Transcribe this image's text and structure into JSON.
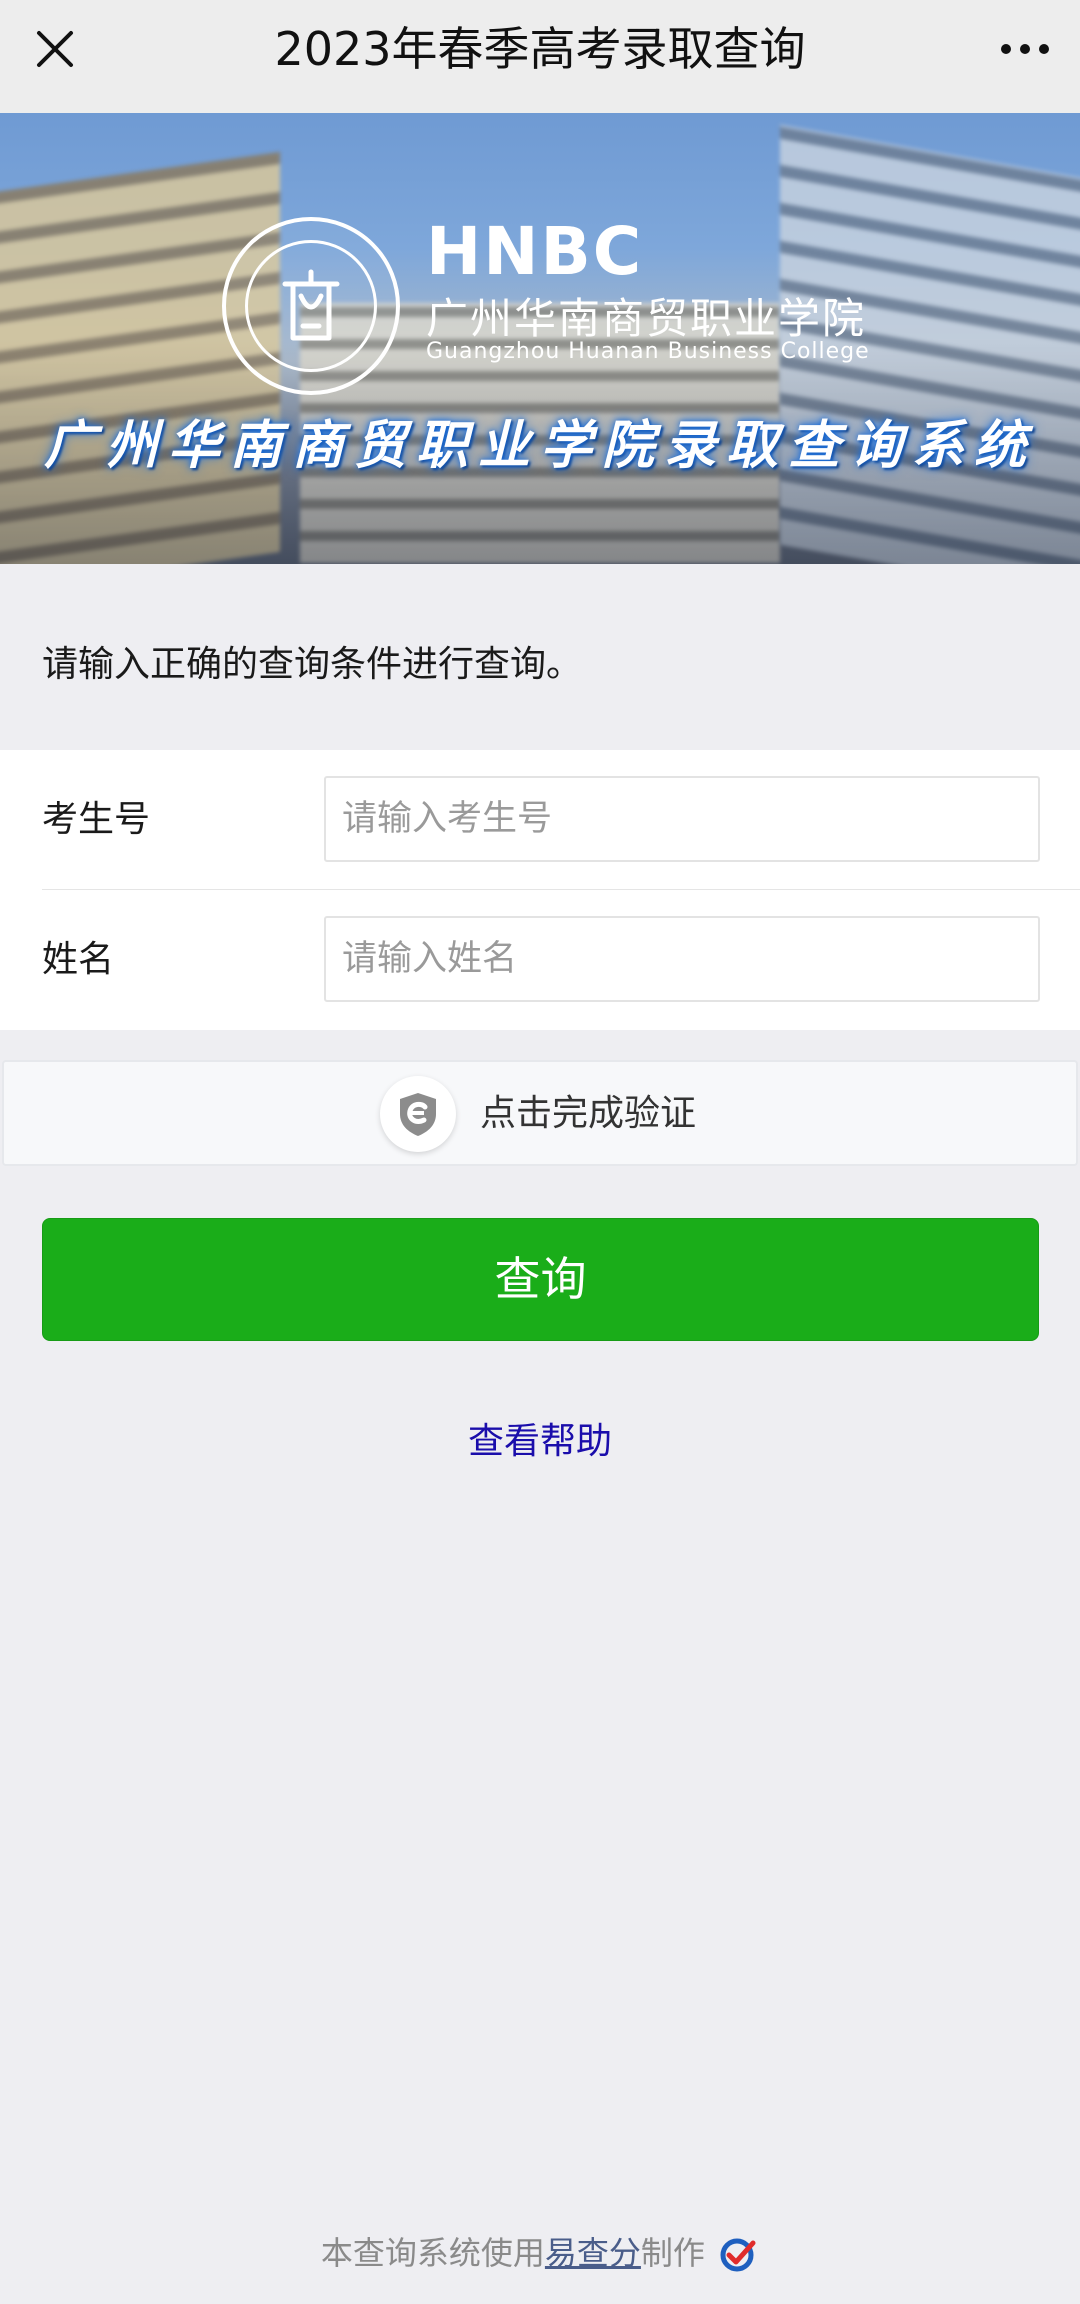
{
  "header": {
    "title": "2023年春季高考录取查询"
  },
  "banner": {
    "abbr": "HNBC",
    "college_name_cn": "广州华南商贸职业学院",
    "college_name_en": "Guangzhou Huanan Business College",
    "system_title": "广州华南商贸职业学院录取查询系统"
  },
  "instruction": "请输入正确的查询条件进行查询。",
  "form": {
    "fields": [
      {
        "label": "考生号",
        "placeholder": "请输入考生号",
        "value": ""
      },
      {
        "label": "姓名",
        "placeholder": "请输入姓名",
        "value": ""
      }
    ]
  },
  "verify": {
    "label": "点击完成验证"
  },
  "query_button": {
    "label": "查询"
  },
  "help_link": {
    "label": "查看帮助"
  },
  "footer": {
    "prefix": "本查询系统使用",
    "brand": "易查分",
    "suffix": "制作"
  },
  "colors": {
    "primary_button": "#1aad19",
    "link": "#1a0dab",
    "background": "#eeeef2"
  }
}
